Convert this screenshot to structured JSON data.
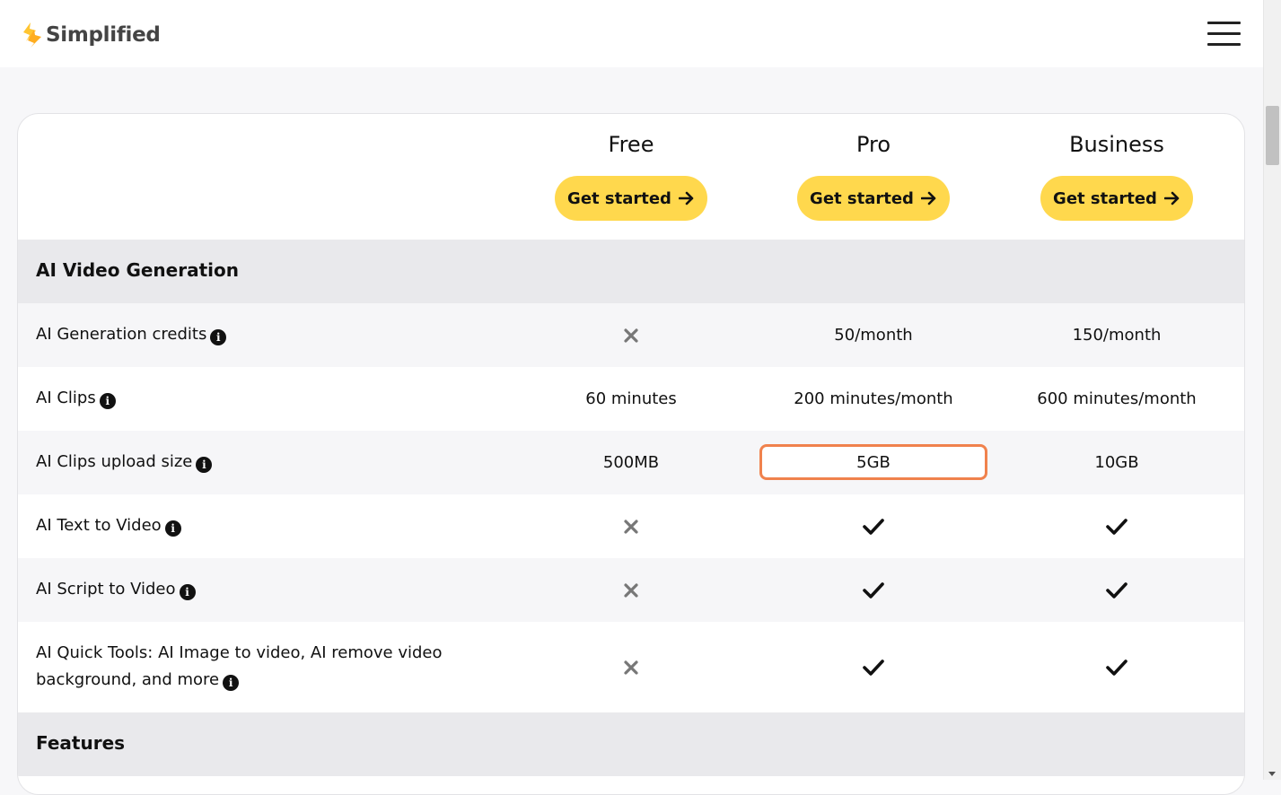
{
  "header": {
    "logo_text": "Simplified",
    "brand_color": "#ffc531"
  },
  "plans": [
    {
      "name": "Free",
      "cta": "Get started"
    },
    {
      "name": "Pro",
      "cta": "Get started"
    },
    {
      "name": "Business",
      "cta": "Get started"
    }
  ],
  "sections": [
    {
      "title": "AI Video Generation"
    },
    {
      "title": "Features"
    }
  ],
  "rows": [
    {
      "feature": "AI Generation credits",
      "values": [
        {
          "type": "cross"
        },
        {
          "type": "text",
          "text": "50/month"
        },
        {
          "type": "text",
          "text": "150/month"
        }
      ]
    },
    {
      "feature": "AI Clips",
      "values": [
        {
          "type": "text",
          "text": "60 minutes"
        },
        {
          "type": "text",
          "text": "200 minutes/month"
        },
        {
          "type": "text",
          "text": "600 minutes/month"
        }
      ]
    },
    {
      "feature": "AI Clips upload size",
      "values": [
        {
          "type": "text",
          "text": "500MB"
        },
        {
          "type": "text",
          "text": "5GB"
        },
        {
          "type": "text",
          "text": "10GB"
        }
      ]
    },
    {
      "feature": "AI Text to Video",
      "values": [
        {
          "type": "cross"
        },
        {
          "type": "check"
        },
        {
          "type": "check"
        }
      ]
    },
    {
      "feature": "AI Script to Video",
      "values": [
        {
          "type": "cross"
        },
        {
          "type": "check"
        },
        {
          "type": "check"
        }
      ]
    },
    {
      "feature_line1": "AI Quick Tools: AI Image to video, AI remove video",
      "feature_line2": "background, and more",
      "values": [
        {
          "type": "cross"
        },
        {
          "type": "check"
        },
        {
          "type": "check"
        }
      ]
    }
  ],
  "colors": {
    "cta_bg": "#ffd84d",
    "highlight_border": "#f0824d",
    "section_bg": "#e9e9ec",
    "cross": "#777777"
  }
}
